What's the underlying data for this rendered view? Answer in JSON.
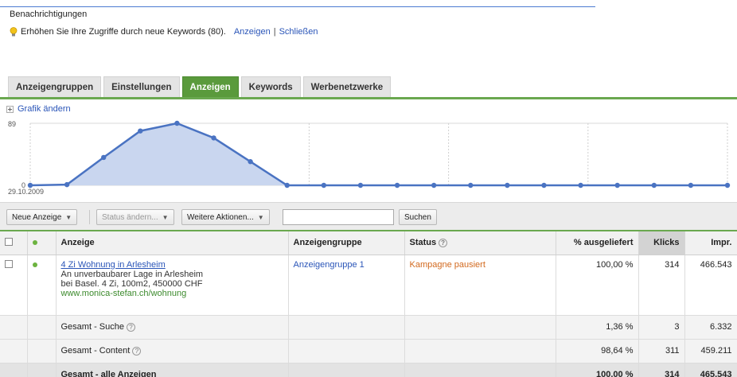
{
  "notification": {
    "title": "Benachrichtigungen",
    "message": "Erhöhen Sie Ihre Zugriffe durch neue Keywords (80).",
    "show_link": "Anzeigen",
    "separator": "|",
    "close_link": "Schließen",
    "icon": "lightbulb-icon"
  },
  "tabs": [
    {
      "label": "Anzeigengruppen",
      "active": false
    },
    {
      "label": "Einstellungen",
      "active": false
    },
    {
      "label": "Anzeigen",
      "active": true
    },
    {
      "label": "Keywords",
      "active": false
    },
    {
      "label": "Werbenetzwerke",
      "active": false
    }
  ],
  "chart_toggle": "Grafik ändern",
  "chart_data": {
    "type": "area",
    "y_max_label": "89",
    "y_min_label": "0",
    "x_start_label": "29.10.2009",
    "ylim": [
      0,
      89
    ],
    "values": [
      0,
      1,
      40,
      78,
      89,
      68,
      34,
      0,
      0,
      0,
      0,
      0,
      0,
      0,
      0,
      0,
      0,
      0,
      0,
      0
    ],
    "grid": true,
    "colors": {
      "line": "#4a73c2",
      "fill": "#c9d6ef"
    }
  },
  "toolbar": {
    "new_ad": "Neue Anzeige",
    "change_status": "Status ändern...",
    "more_actions": "Weitere Aktionen...",
    "search_value": "",
    "search_button": "Suchen"
  },
  "table": {
    "headers": {
      "ad": "Anzeige",
      "adgroup": "Anzeigengruppe",
      "status": "Status",
      "served": "% ausgeliefert",
      "clicks": "Klicks",
      "impr": "Impr."
    },
    "ad": {
      "title": "4 Zi Wohnung in Arlesheim",
      "line1": "An unverbaubarer Lage in Arlesheim",
      "line2": "bei Basel. 4 Zi, 100m2, 450000 CHF",
      "url": "www.monica-stefan.ch/wohnung",
      "adgroup": "Anzeigengruppe 1",
      "status": "Kampagne pausiert",
      "served": "100,00 %",
      "clicks": "314",
      "impr": "466.543"
    },
    "totals": [
      {
        "label": "Gesamt - Suche",
        "help": true,
        "served": "1,36 %",
        "clicks": "3",
        "impr": "6.332"
      },
      {
        "label": "Gesamt - Content",
        "help": true,
        "served": "98,64 %",
        "clicks": "311",
        "impr": "459.211"
      },
      {
        "label": "Gesamt - alle Anzeigen",
        "help": false,
        "served": "100,00 %",
        "clicks": "314",
        "impr": "465.543"
      }
    ]
  },
  "colors": {
    "tab_active": "#5a9a3c",
    "link": "#2a55b8",
    "status_paused": "#d2691e",
    "url_green": "#3c8a2c"
  }
}
